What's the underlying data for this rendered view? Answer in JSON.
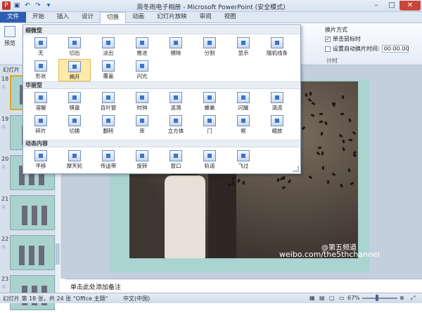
{
  "title": "周冬雨电子相册 - Microsoft PowerPoint (安全模式)",
  "tabs": [
    "文件",
    "开始",
    "插入",
    "设计",
    "切换",
    "动画",
    "幻灯片放映",
    "审阅",
    "视图"
  ],
  "active_tab": "切换",
  "ribbon": {
    "preview": "预览",
    "switch_mode": "换片方式",
    "on_click": "单击鼠标时",
    "auto_after": "设置自动换片时间:",
    "time_value": "00:00.00",
    "timing_group": "计时"
  },
  "gallery": {
    "sections": [
      {
        "title": "细微型",
        "items": [
          "无",
          "切出",
          "淡出",
          "推进",
          "擦除",
          "分割",
          "显示",
          "随机线条",
          "形状",
          "揭开",
          "覆盖",
          "闪光"
        ],
        "selected": "揭开"
      },
      {
        "title": "华丽型",
        "items": [
          "溶解",
          "棋盘",
          "百叶窗",
          "时钟",
          "涟漪",
          "蜂巢",
          "闪耀",
          "涡流",
          "碎片",
          "切换",
          "翻转",
          "库",
          "立方体",
          "门",
          "框",
          "缩放"
        ]
      },
      {
        "title": "动态内容",
        "items": [
          "平移",
          "摩天轮",
          "传送带",
          "旋转",
          "窗口",
          "轨道",
          "飞过"
        ]
      }
    ]
  },
  "left_panel": {
    "header": "幻灯片",
    "slides": [
      {
        "num": "18",
        "selected": true
      },
      {
        "num": "19"
      },
      {
        "num": "20"
      },
      {
        "num": "21"
      },
      {
        "num": "22"
      },
      {
        "num": "23"
      }
    ]
  },
  "slide": {
    "watermark_handle": "@第五频道",
    "watermark_url": "weibo.com/the5thchannel"
  },
  "notes_placeholder": "单击此处添加备注",
  "status": {
    "slide_info": "幻灯片 第 18 张，共 24 张",
    "theme": "\"Office 主题\"",
    "language": "中文(中国)",
    "zoom": "67%"
  }
}
